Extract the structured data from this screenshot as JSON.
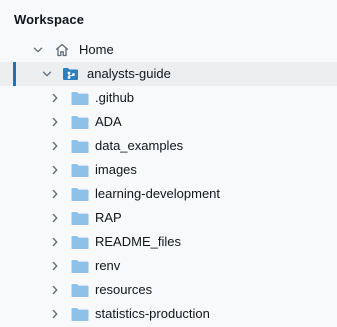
{
  "panel": {
    "title": "Workspace"
  },
  "tree": {
    "home": {
      "label": "Home",
      "icon": "home-icon",
      "expanded": true
    },
    "repo": {
      "label": "analysts-guide",
      "icon": "git-repo-icon",
      "expanded": true,
      "selected": true
    },
    "folders": [
      {
        "label": ".github"
      },
      {
        "label": "ADA"
      },
      {
        "label": "data_examples"
      },
      {
        "label": "images"
      },
      {
        "label": "learning-development"
      },
      {
        "label": "RAP"
      },
      {
        "label": "README_files"
      },
      {
        "label": "renv"
      },
      {
        "label": "resources"
      },
      {
        "label": "statistics-production"
      }
    ]
  },
  "colors": {
    "background": "#f8f9fa",
    "selected_row": "#eceef0",
    "selection_bar": "#2272b4",
    "folder_icon": "#8ec1e8",
    "repo_icon": "#2e7fc0",
    "chevron": "#5f6b76"
  }
}
